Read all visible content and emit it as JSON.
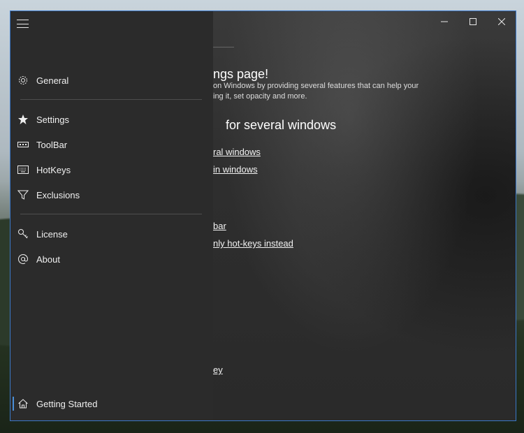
{
  "nav": {
    "items_top": [
      {
        "label": "General",
        "icon": "gear-icon"
      }
    ],
    "items_mid": [
      {
        "label": "Settings",
        "icon": "star-icon"
      },
      {
        "label": "ToolBar",
        "icon": "toolbar-icon"
      },
      {
        "label": "HotKeys",
        "icon": "keyboard-icon"
      },
      {
        "label": "Exclusions",
        "icon": "filter-icon"
      }
    ],
    "items_bottom": [
      {
        "label": "License",
        "icon": "key-icon"
      },
      {
        "label": "About",
        "icon": "at-icon"
      }
    ],
    "footer": {
      "label": "Getting Started",
      "icon": "home-icon"
    }
  },
  "content": {
    "title": "ngs page!",
    "desc_line1": "on Windows by providing several features that can help your",
    "desc_line2": "ing it, set opacity and more.",
    "section_title": "for several windows",
    "links": [
      "ral windows",
      "in windows",
      "bar",
      "nly hot-keys instead",
      "ey"
    ]
  },
  "colors": {
    "accent": "#3b78c8",
    "active_indicator": "#4a8fd8"
  }
}
